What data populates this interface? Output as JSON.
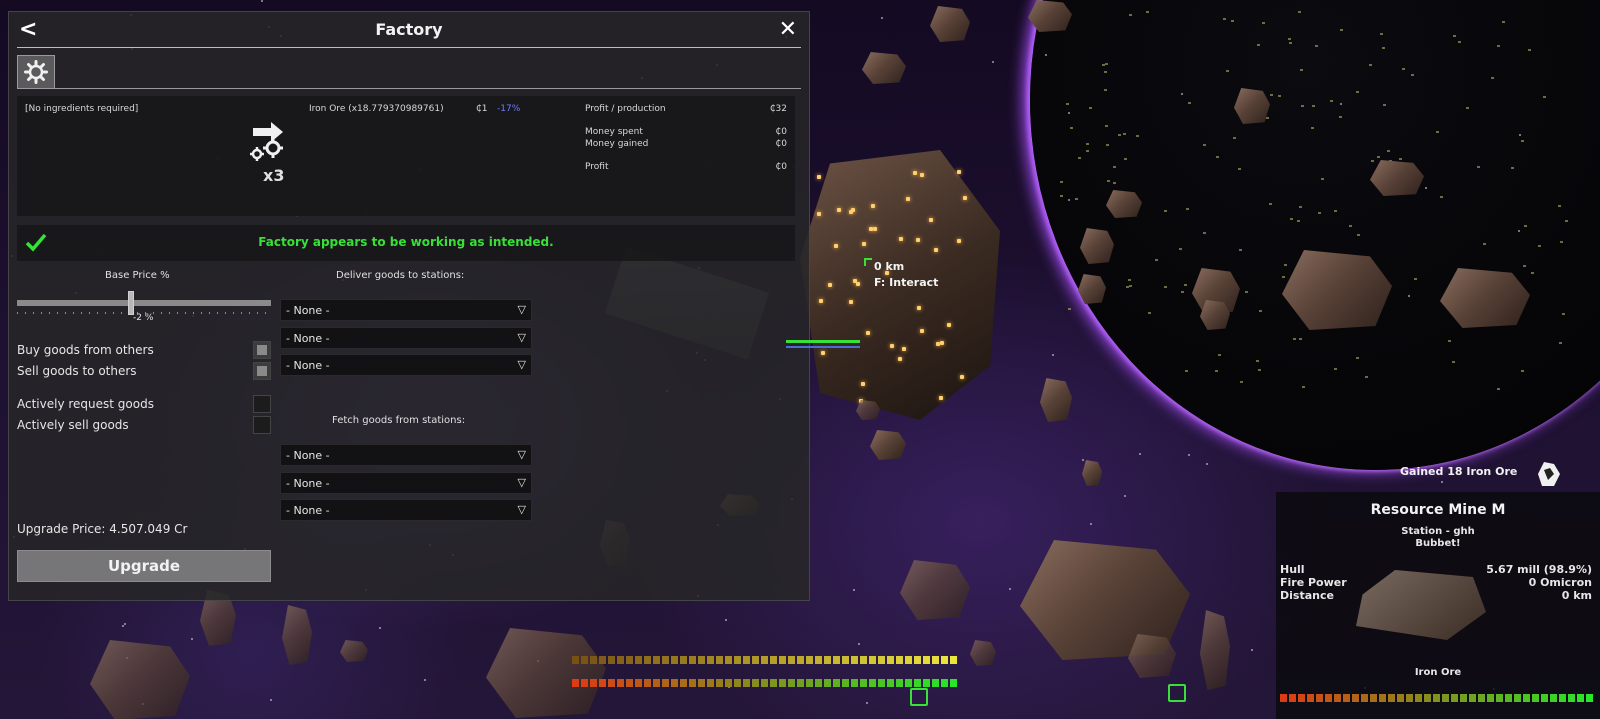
{
  "window": {
    "title": "Factory",
    "back_glyph": "<",
    "close_glyph": "✕",
    "tabs": [
      {
        "icon": "gear-icon"
      }
    ]
  },
  "production": {
    "ingredients": "[No ingredients required]",
    "output": "Iron Ore (x18.779370989761)",
    "output_price": "₵1",
    "output_price_change": "-17%",
    "multiplier": "x3",
    "stats": [
      {
        "label": "Profit / production",
        "value": "₵32"
      },
      {
        "label": "Money spent",
        "value": "₵0"
      },
      {
        "label": "Money gained",
        "value": "₵0"
      },
      {
        "label": "Profit",
        "value": "₵0"
      }
    ]
  },
  "status": {
    "text": "Factory appears to be working as intended.",
    "color": "#38e038"
  },
  "pricing": {
    "base_price_label": "Base Price %",
    "base_price_value": "-2 %",
    "base_price_level": -2
  },
  "options": [
    {
      "label": "Buy goods from others",
      "checked": false,
      "style": "grey"
    },
    {
      "label": "Sell goods to others",
      "checked": false,
      "style": "grey"
    },
    {
      "label": "Actively request goods",
      "checked": false,
      "style": "dark"
    },
    {
      "label": "Actively sell goods",
      "checked": false,
      "style": "dark"
    }
  ],
  "deliver": {
    "label": "Deliver goods to stations:",
    "slots": [
      "- None -",
      "- None -",
      "- None -"
    ]
  },
  "fetch": {
    "label": "Fetch goods from stations:",
    "slots": [
      "- None -",
      "- None -",
      "- None -"
    ]
  },
  "upgrade": {
    "price_text": "Upgrade Price: 4.507.049 Cr",
    "button_label": "Upgrade"
  },
  "hud": {
    "target_distance": "0 km",
    "interact_hint": "F: Interact",
    "notice": "Gained 18 Iron Ore"
  },
  "target_panel": {
    "name": "Resource Mine M",
    "subtitle": "Station - ghh",
    "owner": "Bubbet!",
    "rows": [
      {
        "label": "Hull",
        "value": "5.67 mill (98.9%)"
      },
      {
        "label": "Fire Power",
        "value": "0 Omicron"
      },
      {
        "label": "Distance",
        "value": "0 km"
      }
    ],
    "cargo": "Iron Ore"
  },
  "colors": {
    "accent_green": "#38e038",
    "price_change_blue": "#6f7cff",
    "planet_rim": "#aa50ff"
  }
}
